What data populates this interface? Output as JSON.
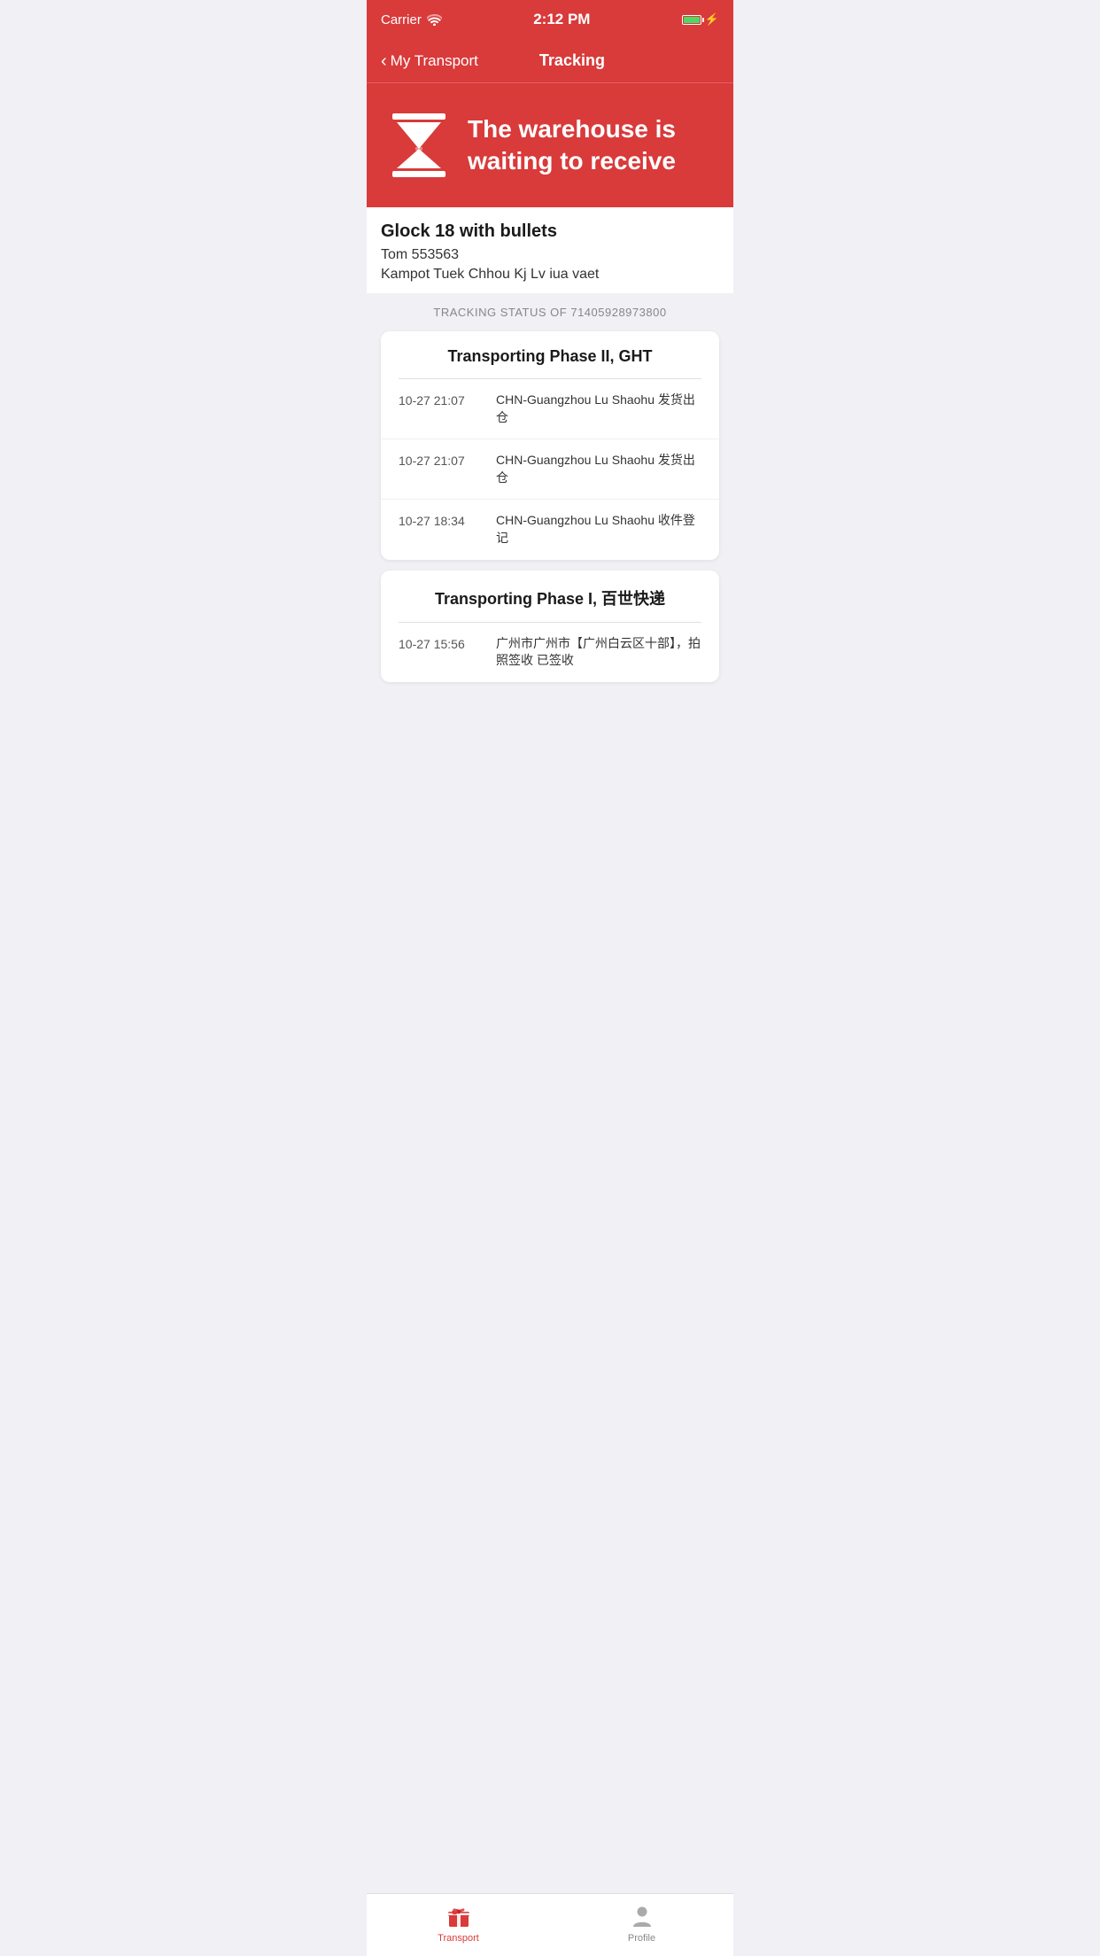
{
  "statusBar": {
    "carrier": "Carrier",
    "time": "2:12 PM"
  },
  "navBar": {
    "backLabel": "My Transport",
    "title": "Tracking"
  },
  "heroBanner": {
    "statusText": "The warehouse is waiting to receive"
  },
  "itemInfo": {
    "name": "Glock 18 with bullets",
    "contact": "Tom 553563",
    "address": "Kampot Tuek Chhou Kj Lv iua vaet"
  },
  "trackingLabel": "TRACKING STATUS OF 71405928973800",
  "cards": [
    {
      "title": "Transporting Phase II, GHT",
      "rows": [
        {
          "time": "10-27 21:07",
          "desc": "CHN-Guangzhou Lu Shaohu 发货出仓"
        },
        {
          "time": "10-27 21:07",
          "desc": "CHN-Guangzhou Lu Shaohu 发货出仓"
        },
        {
          "time": "10-27 18:34",
          "desc": "CHN-Guangzhou Lu Shaohu 收件登记"
        }
      ]
    },
    {
      "title": "Transporting Phase I, 百世快递",
      "rows": [
        {
          "time": "10-27 15:56",
          "desc": "广州市广州市【广州白云区十部】，拍照签收 已签收"
        }
      ]
    }
  ],
  "tabBar": {
    "items": [
      {
        "id": "transport",
        "label": "Transport",
        "active": true
      },
      {
        "id": "profile",
        "label": "Profile",
        "active": false
      }
    ]
  }
}
